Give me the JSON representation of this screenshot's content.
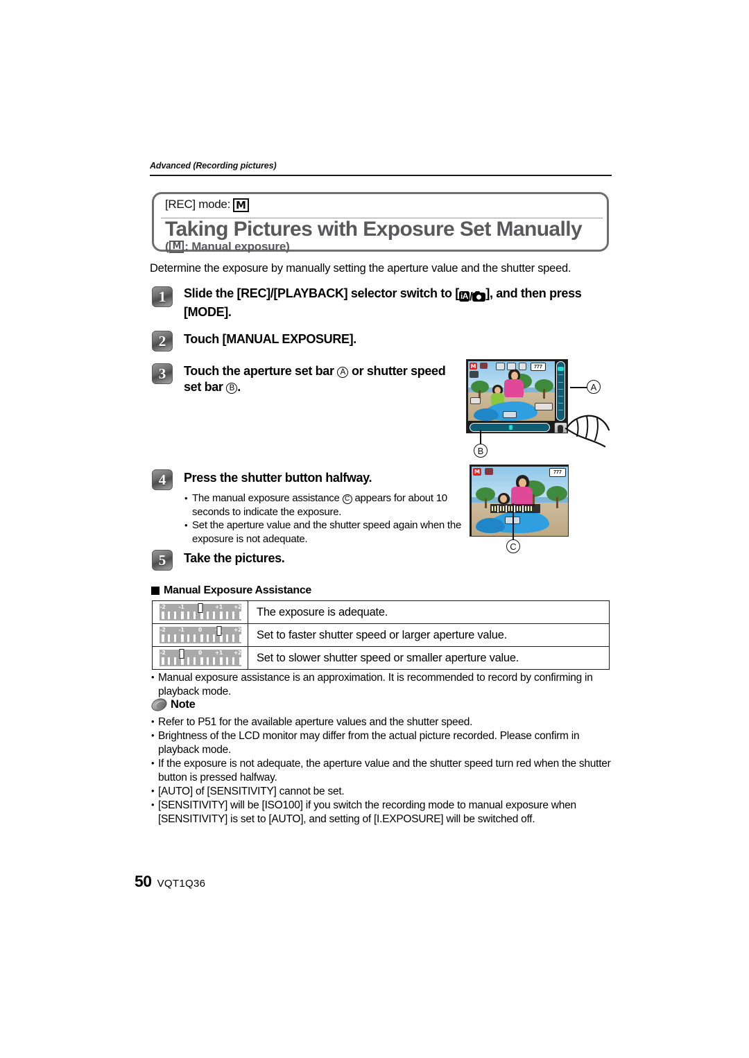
{
  "running_head": "Advanced (Recording pictures)",
  "title_box": {
    "rec_mode_label": "[REC] mode:",
    "rec_mode_icon": "M",
    "title": "Taking Pictures with Exposure Set Manually",
    "subtitle_icon": "M",
    "subtitle": ": Manual exposure)",
    "subtitle_open": "("
  },
  "lead": "Determine the exposure by manually setting the aperture value and the shutter speed.",
  "steps": [
    {
      "num": "1",
      "text_a": "Slide the [REC]/[PLAYBACK] selector switch to [",
      "icon_ia": "iA",
      "icon_sep": "/",
      "icon_cam": "camera-icon",
      "text_b": "], and then press [MODE]."
    },
    {
      "num": "2",
      "text": "Touch [MANUAL EXPOSURE]."
    },
    {
      "num": "3",
      "text_a": "Touch the aperture set bar",
      "ref_a": "A",
      "text_b": "or shutter speed set bar",
      "ref_b": "B",
      "text_c": "."
    },
    {
      "num": "4",
      "text": "Press the shutter button halfway.",
      "bullets": [
        {
          "text_a": "The manual exposure assistance",
          "ref": "C",
          "text_b": "appears for about 10 seconds to indicate the exposure."
        },
        {
          "text_a": "Set the aperture value and the shutter speed again when the exposure is not adequate."
        }
      ]
    },
    {
      "num": "5",
      "text": "Take the pictures."
    }
  ],
  "figures": {
    "figure1": {
      "callout_a": "A",
      "callout_b": "B",
      "osd_mode": "M",
      "osd_battery": "777",
      "hand_icon": "hand-pointing-icon"
    },
    "figure2": {
      "callout_c": "C",
      "osd_mode": "M",
      "osd_battery": "777"
    }
  },
  "assist_section": {
    "heading": "Manual Exposure Assistance",
    "scale_labels": [
      "-2",
      "-1",
      "0",
      "+1",
      "+2"
    ],
    "rows": [
      {
        "marker_value": 0,
        "description": "The exposure is adequate."
      },
      {
        "marker_value": 1,
        "description": "Set to faster shutter speed or larger aperture value."
      },
      {
        "marker_value": -1,
        "description": "Set to slower shutter speed or smaller aperture value."
      }
    ]
  },
  "after_table_bullet": "Manual exposure assistance is an approximation. It is recommended to record by confirming in playback mode.",
  "note": {
    "label": "Note",
    "icon": "pencil-note-icon",
    "bullets": [
      "Refer to P51 for the available aperture values and the shutter speed.",
      "Brightness of the LCD monitor may differ from the actual picture recorded. Please confirm in playback mode.",
      "If the exposure is not adequate, the aperture value and the shutter speed turn red when the shutter button is pressed halfway.",
      "[AUTO] of [SENSITIVITY] cannot be set.",
      "[SENSITIVITY] will be [ISO100] if you switch the recording mode to manual exposure when [SENSITIVITY] is set to [AUTO], and setting of [I.EXPOSURE] will be switched off."
    ]
  },
  "footer": {
    "page_number": "50",
    "doc_code": "VQT1Q36"
  }
}
